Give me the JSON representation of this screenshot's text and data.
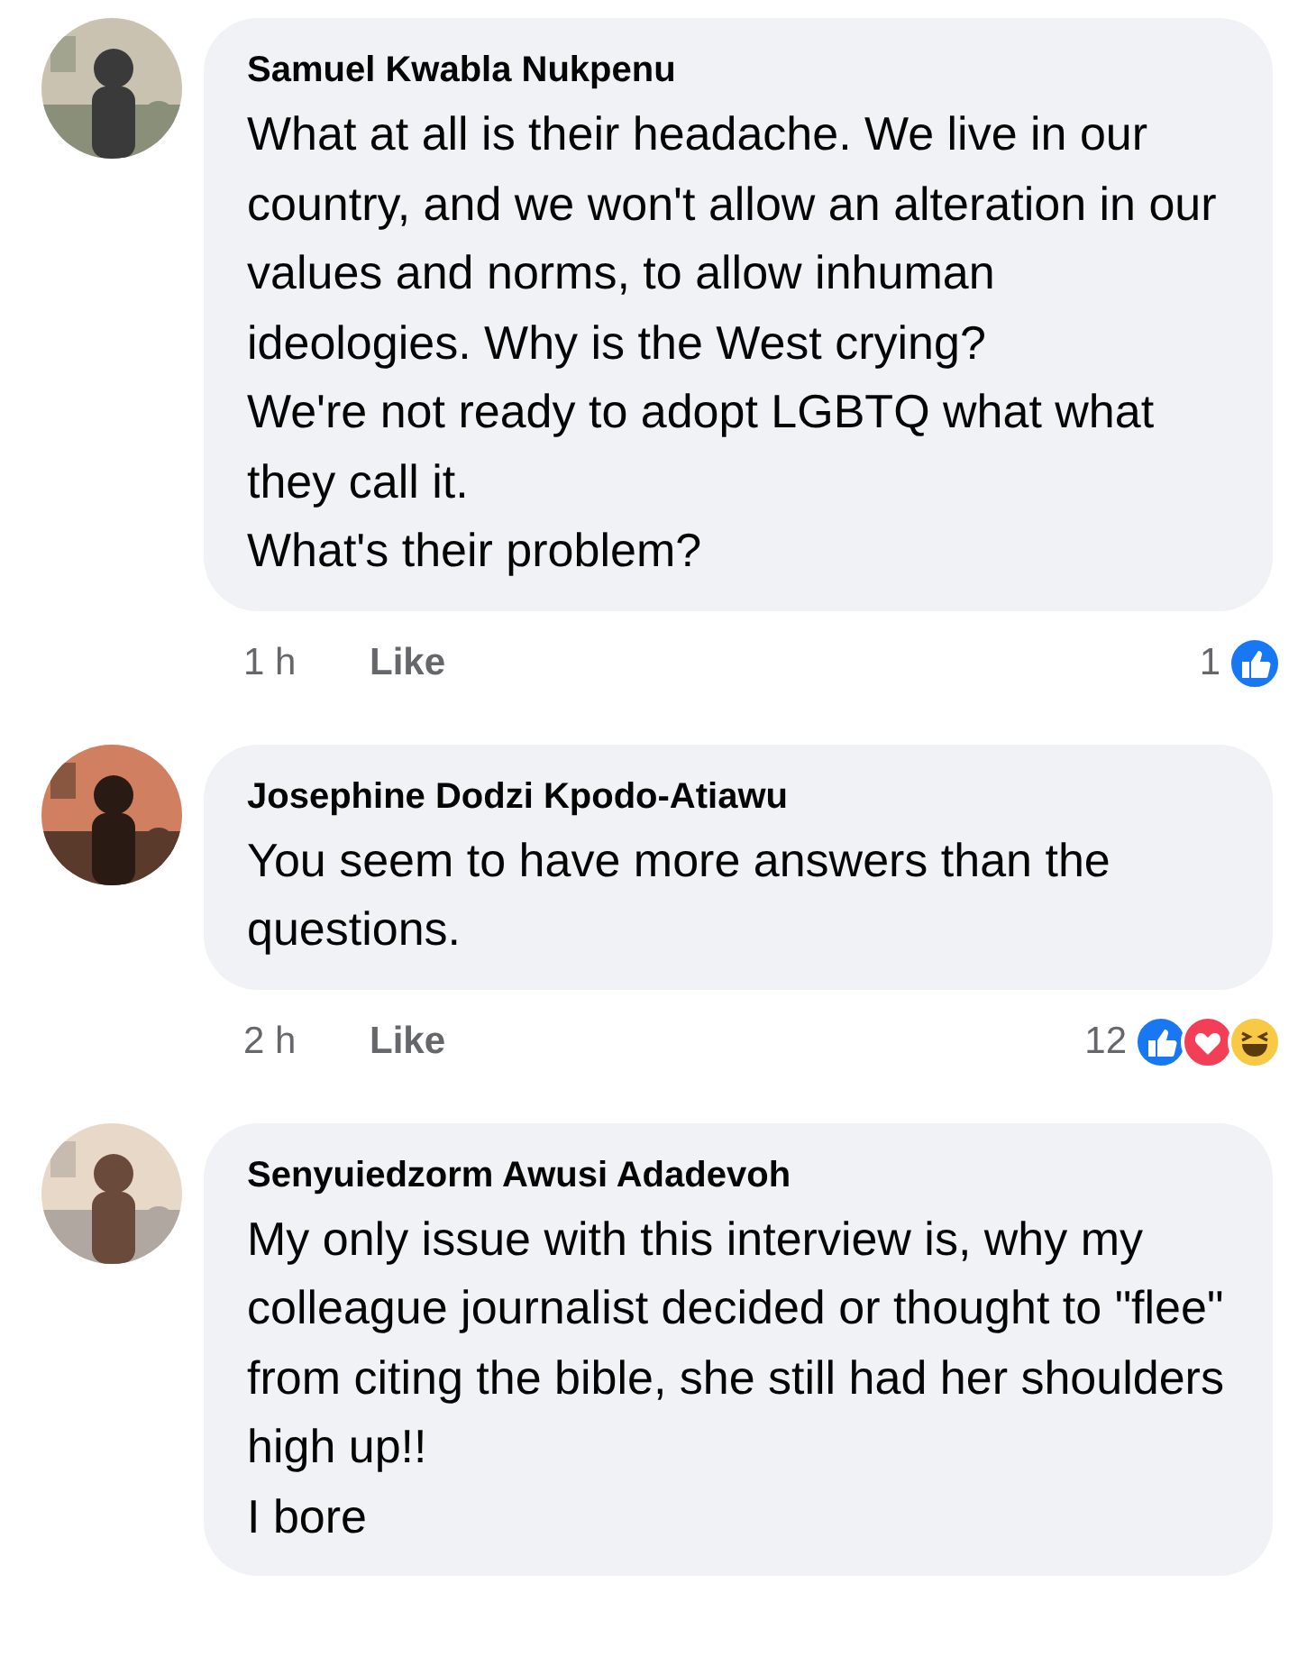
{
  "comments": [
    {
      "author": "Samuel Kwabla Nukpenu",
      "text": "What at all is their headache. We live in our country, and we won't allow an alteration in our values and norms, to allow inhuman ideologies. Why is the West crying?\nWe're not ready to adopt LGBTQ what what they call it.\nWhat's their problem?",
      "time": "1 h",
      "action": "Like",
      "reaction_count": "1",
      "reactions": [
        {
          "kind": "like"
        }
      ]
    },
    {
      "author": "Josephine Dodzi Kpodo-Atiawu",
      "text": "You seem to have more answers than the questions.",
      "time": "2 h",
      "action": "Like",
      "reaction_count": "12",
      "reactions": [
        {
          "kind": "like"
        },
        {
          "kind": "love"
        },
        {
          "kind": "haha"
        }
      ]
    },
    {
      "author": "Senyuiedzorm Awusi Adadevoh",
      "text": "My only issue with this interview is, why my colleague journalist decided or thought to \"flee\" from citing the bible, she still had her shoulders high up!!\nI bore"
    }
  ]
}
